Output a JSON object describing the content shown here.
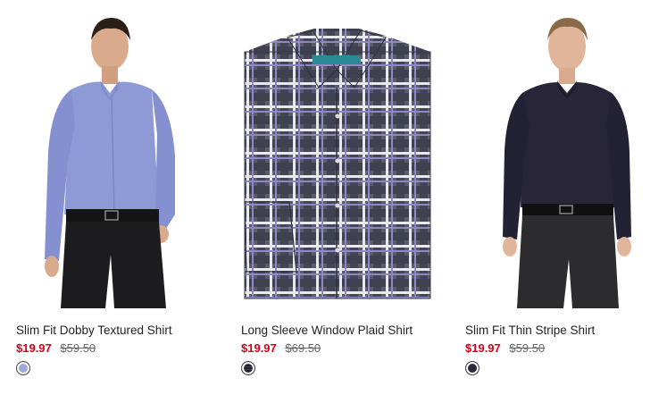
{
  "products": [
    {
      "name": "Slim Fit Dobby Textured Shirt",
      "sale_price": "$19.97",
      "original_price": "$59.50",
      "swatch": {
        "color": "#9ea8d8",
        "pattern": "solid"
      }
    },
    {
      "name": "Long Sleeve Window Plaid Shirt",
      "sale_price": "$19.97",
      "original_price": "$69.50",
      "swatch": {
        "color": "#6d6f7e",
        "pattern": "plaid"
      }
    },
    {
      "name": "Slim Fit Thin Stripe Shirt",
      "sale_price": "$19.97",
      "original_price": "$59.50",
      "swatch": {
        "color": "#2b2a3d",
        "pattern": "solid"
      }
    }
  ],
  "colors": {
    "sale_price": "#d0021b",
    "shirt_blue": "#8e9ad6",
    "shirt_navy": "#272537",
    "plaid_base": "#4c4e5e",
    "pants_black": "#1d1d1f"
  }
}
